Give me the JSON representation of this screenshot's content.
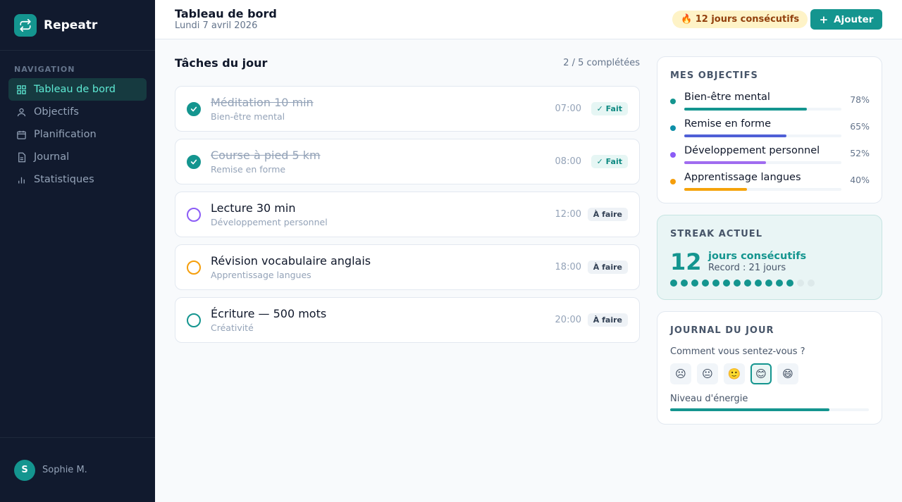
{
  "app": {
    "name": "Repeatr",
    "logo_icon": "repeat-icon"
  },
  "sidebar": {
    "section_label": "NAVIGATION",
    "items": [
      {
        "label": "Tableau de bord",
        "icon": "grid-icon",
        "active": true
      },
      {
        "label": "Objectifs",
        "icon": "user-icon",
        "active": false
      },
      {
        "label": "Planification",
        "icon": "calendar-icon",
        "active": false
      },
      {
        "label": "Journal",
        "icon": "document-icon",
        "active": false
      },
      {
        "label": "Statistiques",
        "icon": "bar-chart-icon",
        "active": false
      }
    ],
    "user": {
      "initial": "S",
      "name": "Sophie M."
    }
  },
  "header": {
    "title": "Tableau de bord",
    "date": "Lundi 7 avril 2026",
    "streak_pill": "🔥 12 jours consécutifs",
    "add_button": "Ajouter"
  },
  "tasks": {
    "title": "Tâches du jour",
    "completed_count": "2 / 5 complétées",
    "items": [
      {
        "title": "Méditation 10 min",
        "category": "Bien-être mental",
        "time": "07:00",
        "status": "✓ Fait",
        "done": true,
        "color": "#14958f"
      },
      {
        "title": "Course à pied 5 km",
        "category": "Remise en forme",
        "time": "08:00",
        "status": "✓ Fait",
        "done": true,
        "color": "#14958f"
      },
      {
        "title": "Lecture 30 min",
        "category": "Développement personnel",
        "time": "12:00",
        "status": "À faire",
        "done": false,
        "color": "#8b5cf6"
      },
      {
        "title": "Révision vocabulaire anglais",
        "category": "Apprentissage langues",
        "time": "18:00",
        "status": "À faire",
        "done": false,
        "color": "#f59e0b"
      },
      {
        "title": "Écriture — 500 mots",
        "category": "Créativité",
        "time": "20:00",
        "status": "À faire",
        "done": false,
        "color": "#14958f"
      }
    ]
  },
  "goals": {
    "title": "MES OBJECTIFS",
    "items": [
      {
        "label": "Bien-être mental",
        "percent": "78%",
        "value": 78,
        "color": "#14958f",
        "bar_color": "#14958f"
      },
      {
        "label": "Remise en forme",
        "percent": "65%",
        "value": 65,
        "color": "#0e8fa8",
        "bar_color": "#4f5fd6"
      },
      {
        "label": "Développement personnel",
        "percent": "52%",
        "value": 52,
        "color": "#8b5cf6",
        "bar_color": "#a06cf0"
      },
      {
        "label": "Apprentissage langues",
        "percent": "40%",
        "value": 40,
        "color": "#f59e0b",
        "bar_color": "#f5a30b"
      }
    ]
  },
  "streak": {
    "title": "STREAK ACTUEL",
    "count": "12",
    "label": "jours consécutifs",
    "record": "Record : 21 jours",
    "days_on": 12,
    "days_total": 14
  },
  "journal": {
    "title": "JOURNAL DU JOUR",
    "question": "Comment vous sentez-vous ?",
    "moods": [
      "☹",
      "😐",
      "🙂",
      "😊",
      "😄"
    ],
    "selected_mood_index": 3,
    "energy_label": "Niveau d'énergie",
    "energy_value": 80
  }
}
